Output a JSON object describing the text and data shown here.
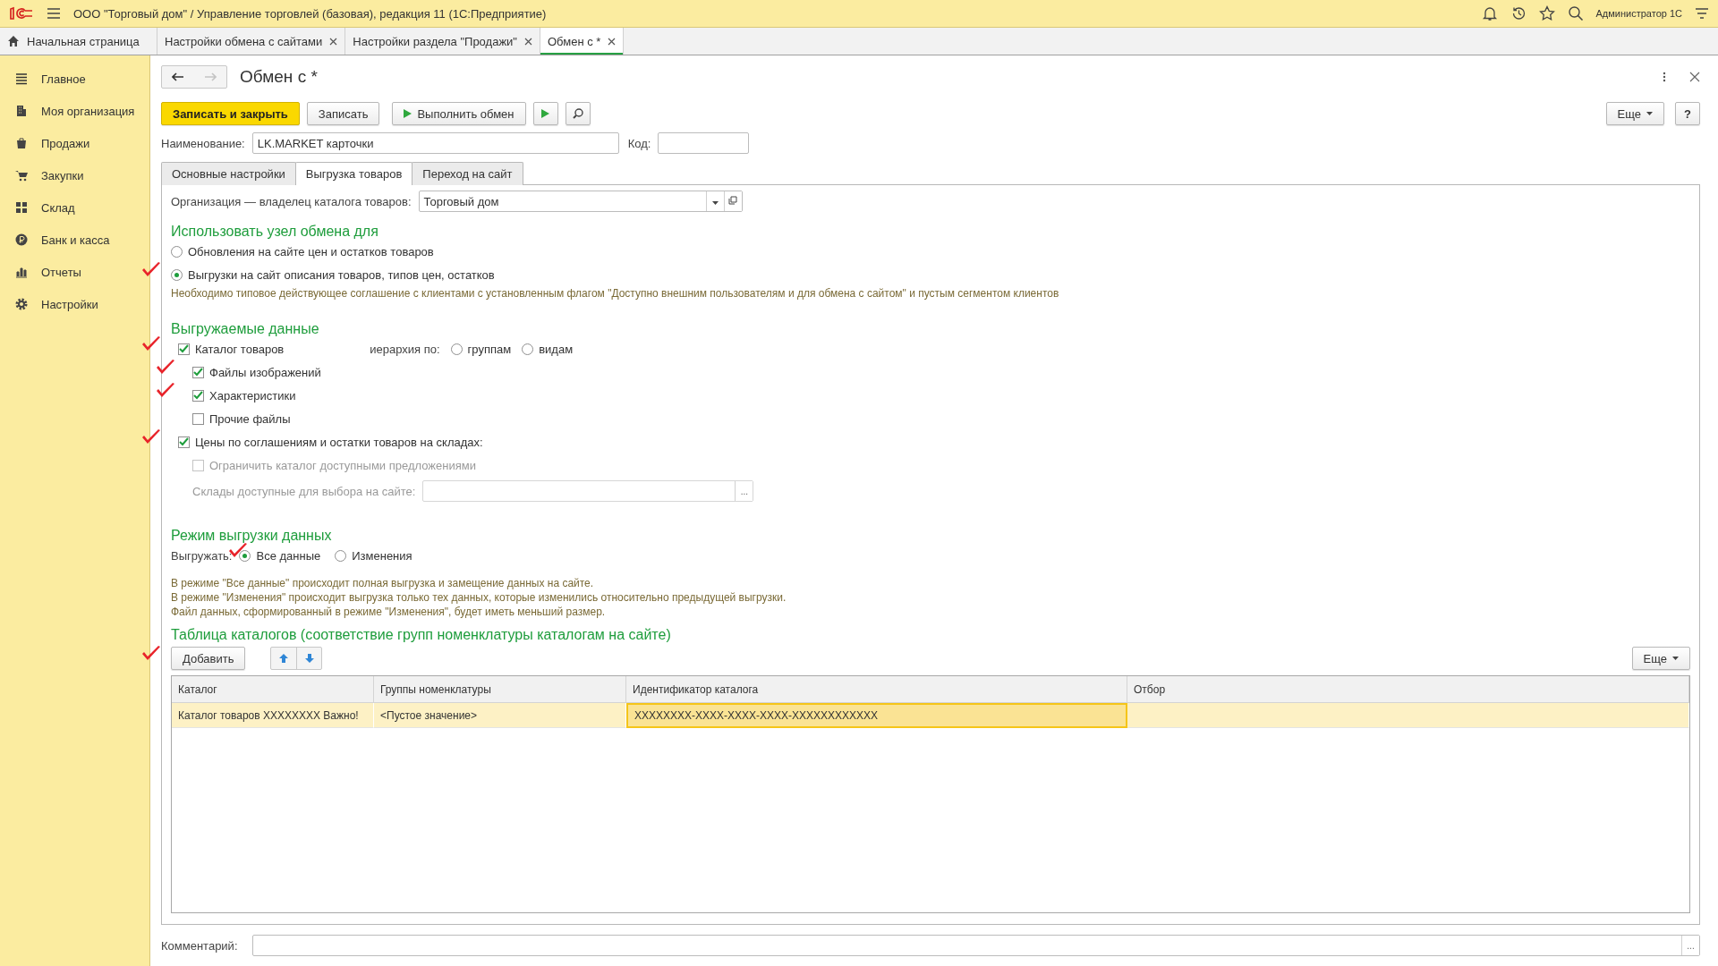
{
  "app_bar": {
    "title": "ООО \"Торговый дом\" / Управление торговлей (базовая), редакция 11  (1С:Предприятие)",
    "user": "Администратор 1С"
  },
  "open_tabs": [
    {
      "kind": "home",
      "label": "Начальная страница",
      "selected": false
    },
    {
      "kind": "doc",
      "label": "Настройки обмена с сайтами",
      "selected": false
    },
    {
      "kind": "doc",
      "label": "Настройки раздела \"Продажи\"",
      "selected": false
    },
    {
      "kind": "doc",
      "label": "Обмен с *",
      "selected": true
    }
  ],
  "sidebar": {
    "items": [
      {
        "kind": "menu",
        "label": "Главное"
      },
      {
        "kind": "building",
        "label": "Моя организация"
      },
      {
        "kind": "bag",
        "label": "Продажи"
      },
      {
        "kind": "cart",
        "label": "Закупки"
      },
      {
        "kind": "grid",
        "label": "Склад"
      },
      {
        "kind": "coin",
        "label": "Банк и касса"
      },
      {
        "kind": "chart",
        "label": "Отчеты"
      },
      {
        "kind": "gear",
        "label": "Настройки"
      }
    ]
  },
  "form": {
    "title": "Обмен с *",
    "toolbar": [
      {
        "kind": "primary",
        "label": "Записать и закрыть"
      },
      {
        "kind": "default",
        "label": "Записать"
      },
      {
        "kind": "run",
        "label": "Выполнить обмен"
      },
      {
        "kind": "play"
      },
      {
        "kind": "find"
      }
    ],
    "more_label": "Еще",
    "help_label": "?",
    "name": {
      "label": "Наименование:",
      "value": "LK.MARKET карточки"
    },
    "code": {
      "label": "Код:"
    },
    "tabs": [
      {
        "label": "Основные настройки",
        "selected": false
      },
      {
        "label": "Выгрузка товаров",
        "selected": true
      },
      {
        "label": "Переход на сайт",
        "selected": false
      }
    ],
    "org": {
      "label": "Организация — владелец каталога товаров:",
      "value": "Торговый дом"
    },
    "usage": {
      "heading": "Использовать узел обмена для",
      "options": [
        {
          "label": "Обновления на сайте цен и остатков товаров",
          "selected": false,
          "marked": false
        },
        {
          "label": "Выгрузки на сайт описания товаров, типов цен, остатков",
          "selected": true,
          "marked": true
        }
      ],
      "note": "Необходимо типовое действующее соглашение с клиентами с установленным флагом \"Доступно внешним пользователям и для обмена с сайтом\" и пустым сегментом клиентов"
    },
    "data": {
      "heading": "Выгружаемые данные",
      "items": [
        {
          "label": "Каталог товаров",
          "checked": true,
          "disabled": false,
          "marked": true,
          "hierarchy": {
            "label": "иерархия по:",
            "options": [
              {
                "label": "группам",
                "selected": false
              },
              {
                "label": "видам",
                "selected": false
              }
            ]
          },
          "children": [
            {
              "label": "Файлы изображений",
              "checked": true,
              "disabled": false,
              "marked": true
            },
            {
              "label": "Характеристики",
              "checked": true,
              "disabled": false,
              "marked": true
            },
            {
              "label": "Прочие файлы",
              "checked": false,
              "disabled": false,
              "marked": false
            }
          ]
        },
        {
          "label": "Цены по соглашениям и остатки товаров на складах:",
          "checked": true,
          "disabled": false,
          "marked": true,
          "children": [
            {
              "label": "Ограничить каталог доступными предложениями",
              "checked": false,
              "disabled": true,
              "marked": false
            }
          ]
        }
      ],
      "warehouses": {
        "label": "Склады доступные для выбора на сайте:",
        "disabled": true,
        "button": "..."
      }
    },
    "mode": {
      "heading": "Режим выгрузки данных",
      "label": "Выгружать:",
      "options": [
        {
          "label": "Все данные",
          "selected": true,
          "marked": true
        },
        {
          "label": "Изменения",
          "selected": false,
          "marked": false
        }
      ],
      "notes": [
        "В режиме \"Все данные\" происходит полная выгрузка  и замещение данных на сайте.",
        "В режиме \"Изменения\" происходит выгрузка только тех данных, которые изменились относительно предыдущей выгрузки.",
        "Файл данных, сформированный в режиме \"Изменения\", будет иметь меньший размер."
      ]
    },
    "catalogs": {
      "heading": "Таблица каталогов (соответствие групп номенклатуры каталогам на сайте)",
      "add_label": "Добавить",
      "add_marked": true,
      "more_label": "Еще",
      "columns": [
        "Каталог",
        "Группы номенклатуры",
        "Идентификатор каталога",
        "Отбор"
      ],
      "rows": [
        {
          "selected": true,
          "cells": [
            {
              "text": "Каталог товаров XXXXXXXX Важно!",
              "current": false
            },
            {
              "text": "<Пустое значение>",
              "current": false
            },
            {
              "text": "XXXXXXXX-XXXX-XXXX-XXXX-XXXXXXXXXXXX",
              "current": true
            },
            {
              "current": false
            }
          ]
        }
      ]
    },
    "comment": {
      "label": "Комментарий:",
      "button": "..."
    }
  }
}
